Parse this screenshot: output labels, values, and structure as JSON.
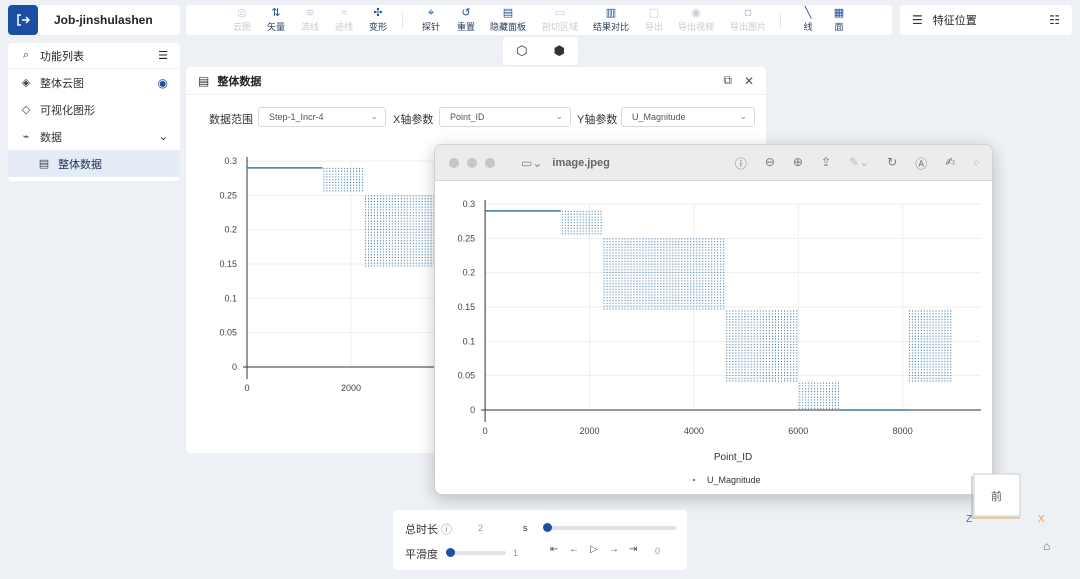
{
  "job": {
    "name": "Job-jinshulashen",
    "icon": "exit-icon"
  },
  "toolbar": {
    "tools": [
      {
        "label": "云图",
        "icon": "contour-icon",
        "enabled": false
      },
      {
        "label": "矢量",
        "icon": "vector-icon",
        "enabled": true
      },
      {
        "label": "流线",
        "icon": "streamline-icon",
        "enabled": false
      },
      {
        "label": "迹线",
        "icon": "pathline-icon",
        "enabled": false
      },
      {
        "label": "变形",
        "icon": "deform-icon",
        "enabled": true
      },
      {
        "label": "探针",
        "icon": "probe-icon",
        "enabled": true
      },
      {
        "label": "重置",
        "icon": "reset-icon",
        "enabled": true
      },
      {
        "label": "隐藏面板",
        "icon": "hide-panel-icon",
        "enabled": true
      },
      {
        "label": "剖切区域",
        "icon": "clip-icon",
        "enabled": false
      },
      {
        "label": "结果对比",
        "icon": "compare-icon",
        "enabled": true
      },
      {
        "label": "导出",
        "icon": "export-icon",
        "enabled": false
      },
      {
        "label": "导出视频",
        "icon": "video-icon",
        "enabled": false
      },
      {
        "label": "导出图片",
        "icon": "camera-icon",
        "enabled": false
      },
      {
        "label": "线",
        "icon": "line-icon",
        "enabled": true
      },
      {
        "label": "面",
        "icon": "grid-icon",
        "enabled": true
      }
    ]
  },
  "feature": {
    "label": "特征位置"
  },
  "sidebar": {
    "title": "功能列表",
    "items": [
      {
        "label": "整体云图"
      },
      {
        "label": "可视化图形"
      },
      {
        "label": "数据"
      },
      {
        "label": "整体数据"
      }
    ]
  },
  "panel": {
    "title": "整体数据",
    "range_label": "数据范围",
    "range_value": "Step-1_Incr-4",
    "x_label": "X轴参数",
    "x_value": "Point_ID",
    "y_label": "Y轴参数",
    "y_value": "U_Magnitude"
  },
  "viewer": {
    "title": "image.jpeg"
  },
  "controls": {
    "duration_label": "总时长",
    "duration_value": "2",
    "duration_unit": "s",
    "smooth_label": "平滑度",
    "smooth_value": "1",
    "frame_value": "0"
  },
  "gizmo": {
    "face": "前",
    "z": "Z",
    "x": "X"
  },
  "chart_data": [
    {
      "type": "scatter",
      "title": "",
      "xlabel": "",
      "ylabel": "",
      "xlim": [
        -500,
        9500
      ],
      "ylim": [
        0,
        0.3
      ],
      "x_ticks": [
        "0",
        "2000"
      ],
      "y_ticks": [
        "0",
        "0.05",
        "0.1",
        "0.15",
        "0.2",
        "0.25",
        "0.3"
      ],
      "series": [
        {
          "segments": [
            {
              "x": [
                0,
                1450
              ],
              "y": [
                0.29,
                0.29
              ]
            },
            {
              "x": [
                1450,
                2250
              ],
              "y": [
                0.255,
                0.29
              ]
            },
            {
              "x": [
                2250,
                4600
              ],
              "y": [
                0.145,
                0.25
              ]
            },
            {
              "x": [
                4600,
                6000
              ],
              "y": [
                0.04,
                0.145
              ]
            },
            {
              "x": [
                6000,
                6800
              ],
              "y": [
                0.0,
                0.04
              ]
            },
            {
              "x": [
                6800,
                8100
              ],
              "y": [
                0.0,
                0.0
              ]
            },
            {
              "x": [
                8100,
                8950
              ],
              "y": [
                0.04,
                0.145
              ]
            }
          ]
        }
      ],
      "grid": true
    },
    {
      "type": "scatter",
      "title": "",
      "xlabel": "Point_ID",
      "ylabel": "",
      "xlim": [
        -500,
        9500
      ],
      "ylim": [
        0,
        0.3
      ],
      "x_ticks": [
        "0",
        "2000",
        "4000",
        "6000",
        "8000"
      ],
      "y_ticks": [
        "0",
        "0.05",
        "0.1",
        "0.15",
        "0.2",
        "0.25",
        "0.3"
      ],
      "legend": "U_Magnitude",
      "legend_position": "bottom",
      "series": [
        {
          "name": "U_Magnitude",
          "segments": [
            {
              "x": [
                0,
                1450
              ],
              "y": [
                0.29,
                0.29
              ]
            },
            {
              "x": [
                1450,
                2250
              ],
              "y": [
                0.255,
                0.29
              ]
            },
            {
              "x": [
                2250,
                4600
              ],
              "y": [
                0.145,
                0.25
              ]
            },
            {
              "x": [
                4600,
                6000
              ],
              "y": [
                0.04,
                0.145
              ]
            },
            {
              "x": [
                6000,
                6800
              ],
              "y": [
                0.0,
                0.04
              ]
            },
            {
              "x": [
                6800,
                8100
              ],
              "y": [
                0.0,
                0.0
              ]
            },
            {
              "x": [
                8100,
                8950
              ],
              "y": [
                0.04,
                0.145
              ]
            }
          ]
        }
      ],
      "grid": true
    }
  ],
  "colors": {
    "accent": "#1c4fa1",
    "series": "#3a78a8"
  }
}
